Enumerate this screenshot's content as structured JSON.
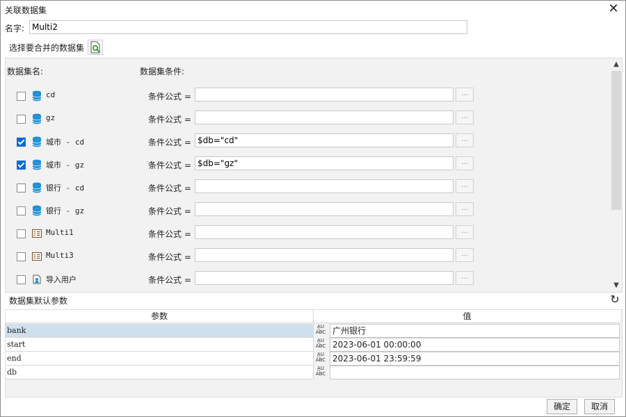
{
  "dialog": {
    "title": "关联数据集",
    "close_icon": "close-icon"
  },
  "name": {
    "label": "名字:",
    "value": "Multi2"
  },
  "select": {
    "label": "选择要合并的数据集"
  },
  "datasets": {
    "header_name": "数据集名:",
    "header_condition": "数据集条件:",
    "condition_label": "条件公式 =",
    "more_label": "...",
    "rows": [
      {
        "name": "cd",
        "checked": false,
        "icon": "database-icon",
        "condition": ""
      },
      {
        "name": "gz",
        "checked": false,
        "icon": "database-icon",
        "condition": ""
      },
      {
        "name": "城市 - cd",
        "checked": true,
        "icon": "database-icon",
        "condition": "$db=\"cd\""
      },
      {
        "name": "城市 - gz",
        "checked": true,
        "icon": "database-icon",
        "condition": "$db=\"gz\""
      },
      {
        "name": "银行 - cd",
        "checked": false,
        "icon": "database-icon",
        "condition": ""
      },
      {
        "name": "银行 - gz",
        "checked": false,
        "icon": "database-icon",
        "condition": ""
      },
      {
        "name": "Multi1",
        "checked": false,
        "icon": "multi-dataset-icon",
        "condition": ""
      },
      {
        "name": "Multi3",
        "checked": false,
        "icon": "multi-dataset-icon",
        "condition": ""
      },
      {
        "name": "导入用户",
        "checked": false,
        "icon": "import-user-icon",
        "condition": ""
      }
    ]
  },
  "params": {
    "label": "数据集默认参数",
    "col_param": "参数",
    "col_value": "值",
    "type_label": "ABC",
    "rows": [
      {
        "name": "bank",
        "value": "广州银行",
        "selected": true
      },
      {
        "name": "start",
        "value": "2023-06-01 00:00:00",
        "selected": false
      },
      {
        "name": "end",
        "value": "2023-06-01 23:59:59",
        "selected": false
      },
      {
        "name": "db",
        "value": "",
        "selected": false
      }
    ]
  },
  "footer": {
    "ok": "确定",
    "cancel": "取消"
  },
  "colors": {
    "accent": "#0a6ad4",
    "db_icon": "#1e90d6",
    "selected_row": "#cfe0ec"
  }
}
